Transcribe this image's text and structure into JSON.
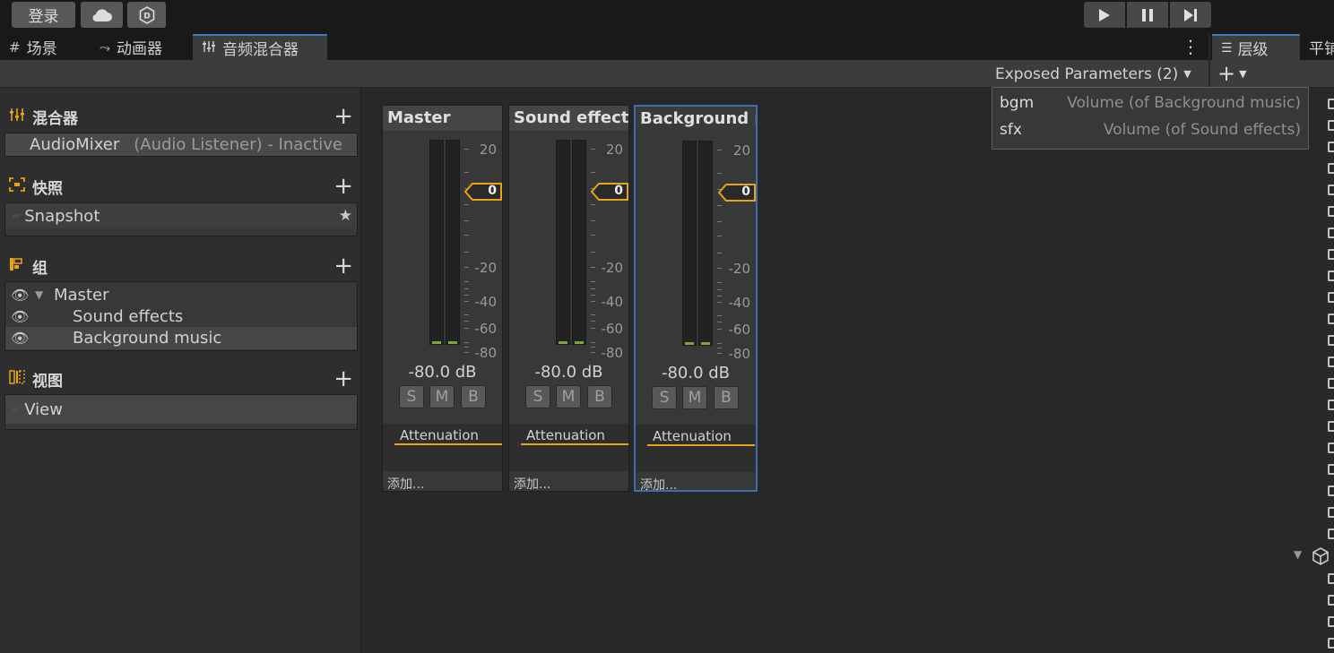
{
  "toolbar": {
    "login_label": "登录",
    "cloud_icon": "cloud-icon",
    "collab_icon": "unity-collab-icon",
    "play_icon": "play-icon",
    "pause_icon": "pause-icon",
    "step_icon": "step-icon"
  },
  "tabs": {
    "scene": {
      "icon": "#",
      "label": "场景"
    },
    "animator": {
      "icon": "⤳",
      "label": "动画器"
    },
    "mixer": {
      "icon": "⫶",
      "label": "音频混合器"
    },
    "hierarchy": {
      "icon": "☰",
      "label": "层级"
    },
    "flat": "平铺"
  },
  "exposed": {
    "label": "Exposed Parameters (2)",
    "params": [
      {
        "name": "bgm",
        "desc": "Volume (of Background music)"
      },
      {
        "name": "sfx",
        "desc": "Volume (of Sound effects)"
      }
    ]
  },
  "sections": {
    "mixers": {
      "title": "混合器",
      "item_name": "AudioMixer",
      "item_status": "(Audio Listener) - Inactive"
    },
    "snapshots": {
      "title": "快照",
      "item": "Snapshot"
    },
    "groups": {
      "title": "组",
      "items": [
        "Master",
        "Sound effects",
        "Background music"
      ]
    },
    "views": {
      "title": "视图",
      "item": "View"
    }
  },
  "strips": [
    {
      "name": "Master",
      "level": 0,
      "db": "-80.0 dB",
      "effect": "Attenuation"
    },
    {
      "name": "Sound effects",
      "level": 0,
      "db": "-80.0 dB",
      "effect": "Attenuation"
    },
    {
      "name": "Background music",
      "level": 0,
      "db": "-80.0 dB",
      "effect": "Attenuation"
    }
  ],
  "strip_common": {
    "scale": [
      "20",
      "-20",
      "-40",
      "-60",
      "-80"
    ],
    "solo": "S",
    "mute": "M",
    "bypass": "B",
    "add_label": "添加..."
  },
  "colors": {
    "accent": "#e8a317",
    "selection": "#3a79bb",
    "meter_green": "#7ea43f"
  }
}
